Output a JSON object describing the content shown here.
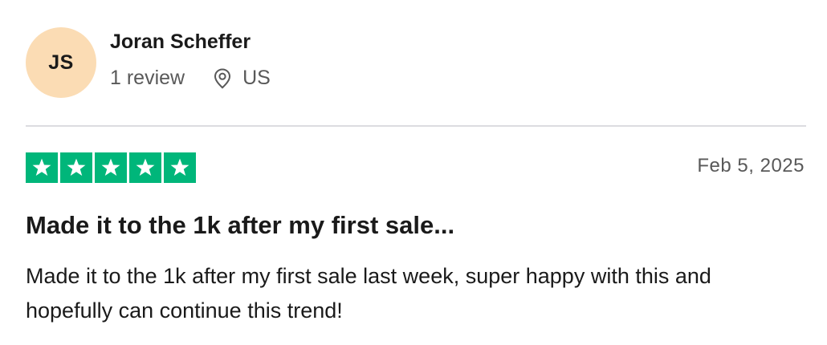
{
  "reviewer": {
    "initials": "JS",
    "name": "Joran Scheffer",
    "review_count": "1 review",
    "location": "US",
    "avatar_color": "#fbdcb4"
  },
  "review": {
    "rating": 5,
    "rating_max": 5,
    "star_color": "#00b67a",
    "date": "Feb 5, 2025",
    "title": "Made it to the 1k after my first sale...",
    "body": "Made it to the 1k after my first sale last week, super happy with this and hopefully can continue this trend!"
  },
  "icons": {
    "location": "map-pin-icon",
    "star": "star-icon"
  }
}
